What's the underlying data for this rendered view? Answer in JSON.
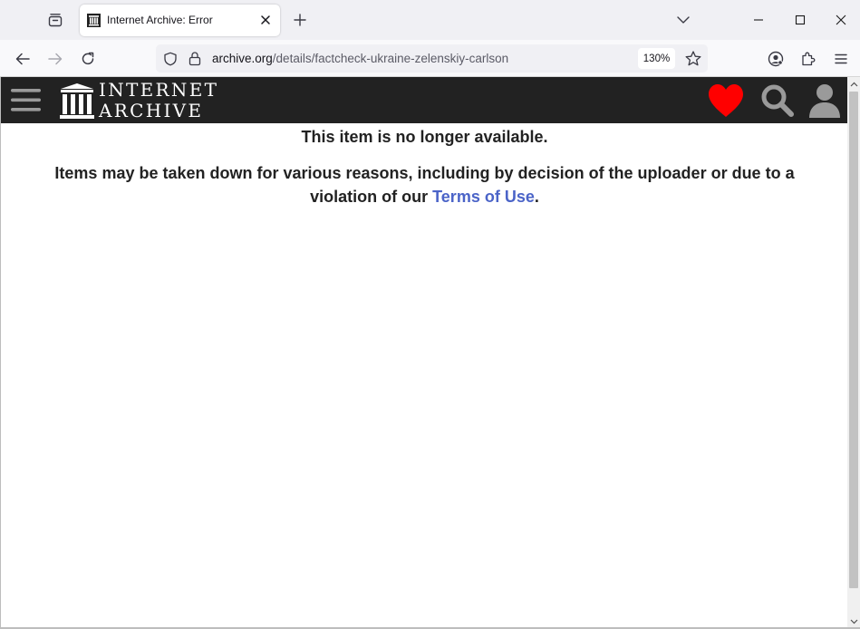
{
  "browser": {
    "tab": {
      "title": "Internet Archive: Error",
      "favicon": "internet-archive-icon"
    },
    "url": {
      "host": "archive.org",
      "path": "/details/factcheck-ukraine-zelenskiy-carlson"
    },
    "zoom": "130%",
    "icons": {
      "tab_list": "tab-list-icon",
      "new_tab": "plus-icon",
      "tabs_overflow": "chevron-down-icon",
      "back": "arrow-left-icon",
      "forward": "arrow-right-icon",
      "reload": "reload-icon",
      "tracking": "shield-icon",
      "lock": "lock-icon",
      "bookmark": "star-icon",
      "account": "account-icon",
      "extensions": "puzzle-icon",
      "menu": "hamburger-menu-icon"
    }
  },
  "site": {
    "logo_line1": "INTERNET",
    "logo_line2": "ARCHIVE",
    "heart_color": "#ff0000",
    "header_bg": "#222222"
  },
  "message": {
    "title": "This item is no longer available.",
    "body_prefix": "Items may be taken down for various reasons, including by decision of the uploader or due to a violation of our ",
    "link_text": "Terms of Use",
    "body_suffix": "."
  },
  "colors": {
    "link": "#4b64c8",
    "text": "#222222"
  }
}
